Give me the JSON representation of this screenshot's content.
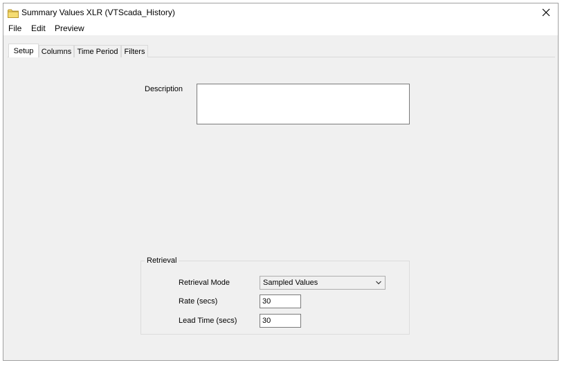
{
  "window": {
    "title": "Summary Values XLR (VTScada_History)"
  },
  "menu": {
    "items": [
      "File",
      "Edit",
      "Preview"
    ]
  },
  "tabs": [
    "Setup",
    "Columns",
    "Time Period",
    "Filters"
  ],
  "setup": {
    "description_label": "Description",
    "description_value": ""
  },
  "retrieval": {
    "group_title": "Retrieval",
    "mode_label": "Retrieval Mode",
    "mode_value": "Sampled Values",
    "rate_label": "Rate (secs)",
    "rate_value": "30",
    "lead_label": "Lead Time (secs)",
    "lead_value": "30"
  },
  "icons": {
    "window": "folder-icon",
    "close": "close-icon",
    "dropdown": "chevron-down-icon"
  },
  "colors": {
    "folder": "#f0d060",
    "window_bg": "#f0f0f0"
  }
}
